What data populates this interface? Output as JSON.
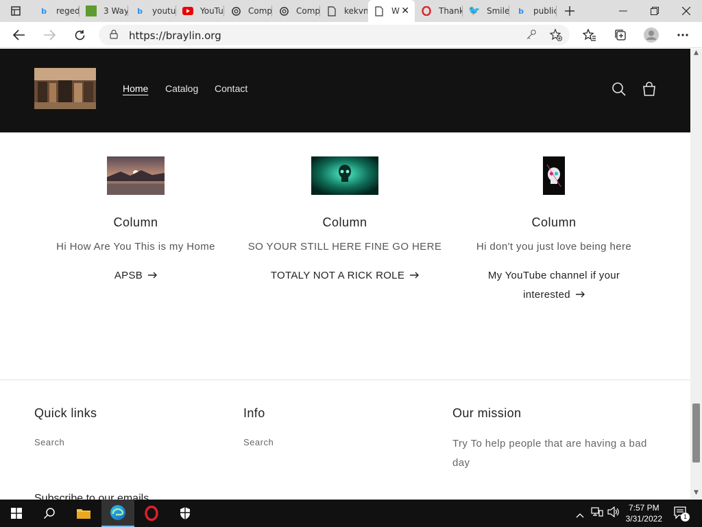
{
  "browser": {
    "tabs": [
      {
        "label": "reged",
        "icon": "bing-icon",
        "active": false
      },
      {
        "label": "3 Way",
        "icon": "minecraft-icon",
        "active": false
      },
      {
        "label": "youtu",
        "icon": "bing-icon",
        "active": false
      },
      {
        "label": "YouTu",
        "icon": "youtube-icon",
        "active": false
      },
      {
        "label": "Comp",
        "icon": "openai-icon",
        "active": false
      },
      {
        "label": "Comp",
        "icon": "openai-icon",
        "active": false
      },
      {
        "label": "kekvn",
        "icon": "page-icon",
        "active": false
      },
      {
        "label": "W",
        "icon": "page-icon",
        "active": true
      },
      {
        "label": "Thank",
        "icon": "opera-icon",
        "active": false
      },
      {
        "label": "Smile",
        "icon": "twitter-icon",
        "active": false
      },
      {
        "label": "public",
        "icon": "bing-icon",
        "active": false
      }
    ],
    "url": "https://braylin.org"
  },
  "site": {
    "nav": {
      "home": "Home",
      "catalog": "Catalog",
      "contact": "Contact"
    },
    "columns": [
      {
        "heading": "Column",
        "text": "Hi How Are You This is my Home",
        "link": "APSB"
      },
      {
        "heading": "Column",
        "text": "SO YOUR STILL HERE FINE GO HERE",
        "link": "TOTALY NOT A RICK ROLE"
      },
      {
        "heading": "Column",
        "text": "Hi don't you just love being here",
        "link_line1": "My YouTube channel if your",
        "link_line2": "interested"
      }
    ],
    "footer": {
      "quick_links": {
        "title": "Quick links",
        "link": "Search"
      },
      "info": {
        "title": "Info",
        "link": "Search"
      },
      "mission": {
        "title": "Our mission",
        "text": "Try To help people that are having a bad day"
      },
      "cut_text": "Subscribe to our emails"
    }
  },
  "taskbar": {
    "time": "7:57 PM",
    "date": "3/31/2022",
    "notification_count": "1"
  },
  "colors": {
    "header_bg": "#121212",
    "accent": "#76b9ed"
  }
}
